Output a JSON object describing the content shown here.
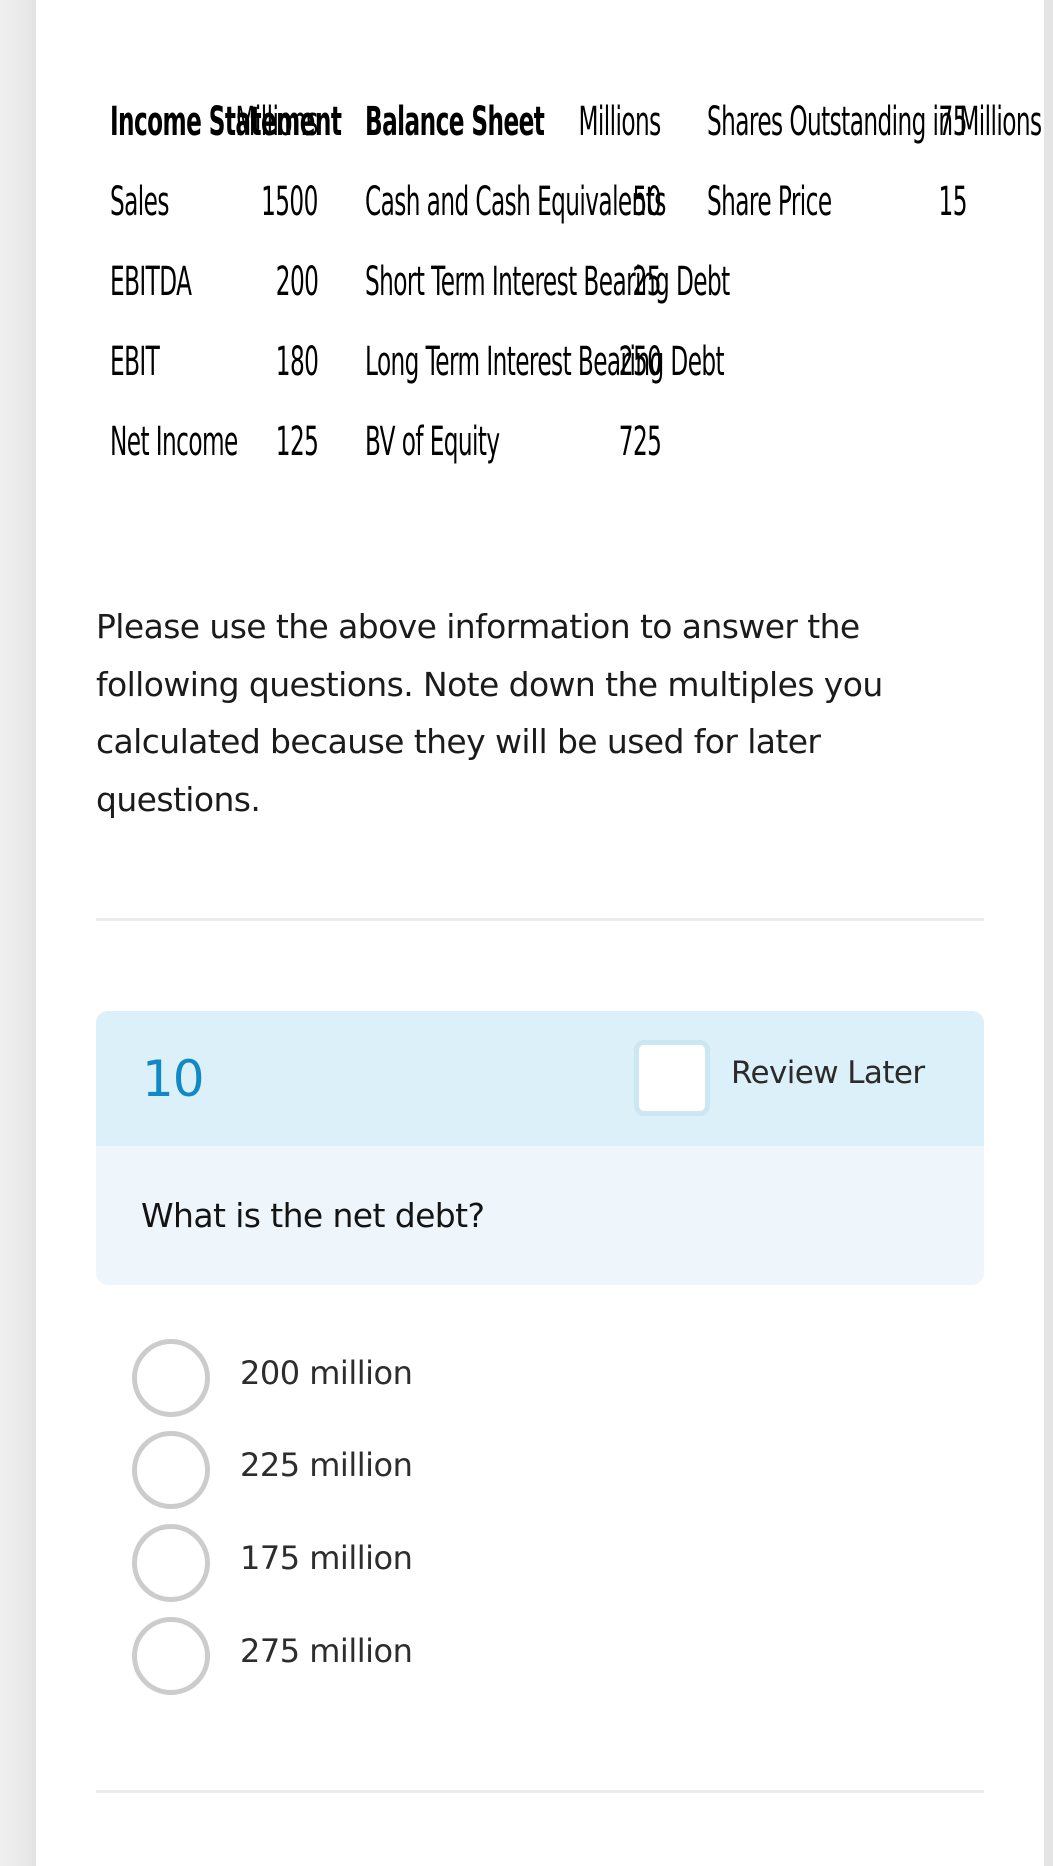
{
  "financials": {
    "income_statement": {
      "header": "Income Statement",
      "unit_header": "Millions",
      "rows": [
        {
          "label": "Sales",
          "value": "1500"
        },
        {
          "label": "EBITDA",
          "value": "200"
        },
        {
          "label": "EBIT",
          "value": "180"
        },
        {
          "label": "Net Income",
          "value": "125"
        }
      ]
    },
    "balance_sheet": {
      "header": "Balance Sheet",
      "unit_header": "Millions",
      "rows": [
        {
          "label": "Cash and Cash Equivalents",
          "value": "50"
        },
        {
          "label": "Short Term Interest Bearing Debt",
          "value": "25"
        },
        {
          "label": "Long Term Interest Bearing Debt",
          "value": "250"
        },
        {
          "label": "BV of Equity",
          "value": "725"
        }
      ]
    },
    "market_data": {
      "rows": [
        {
          "label": "Shares Outstanding in Millions",
          "value": "75"
        },
        {
          "label": "Share Price",
          "value": "15"
        }
      ]
    }
  },
  "instructions": "Please use the above information to answer the following questions. Note down the multiples you calculated because they will be used for later questions.",
  "question": {
    "number": "10",
    "review_later_label": "Review Later",
    "review_later_checked": false,
    "text": "What is the net debt?",
    "options": [
      {
        "label": "200 million",
        "selected": false
      },
      {
        "label": "225 million",
        "selected": false
      },
      {
        "label": "175 million",
        "selected": false
      },
      {
        "label": "275 million",
        "selected": false
      }
    ]
  },
  "colors": {
    "accent": "#0f8ac6",
    "header_bg": "#dcf0f9",
    "body_bg": "#eef6fc",
    "radio_border": "#cccccc"
  }
}
